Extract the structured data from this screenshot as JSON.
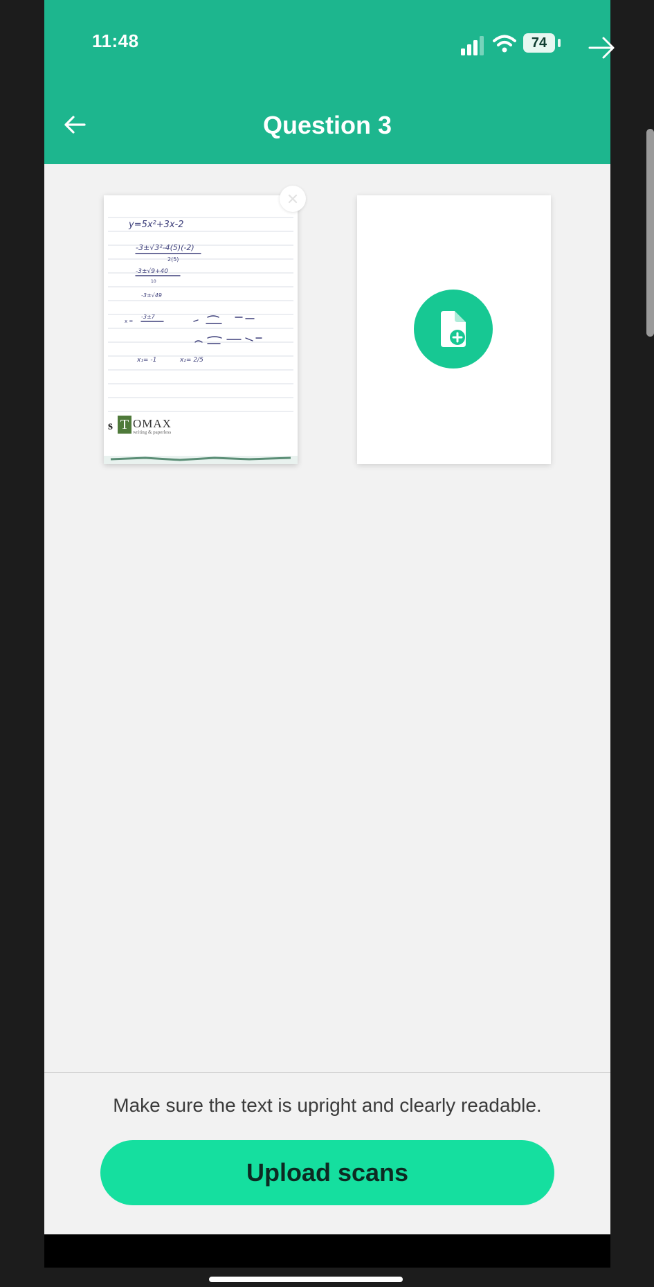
{
  "status_bar": {
    "time": "11:48",
    "battery": "74",
    "icons": [
      "signal-icon",
      "wifi-icon",
      "battery-icon"
    ]
  },
  "header": {
    "title": "Question 3",
    "back_icon": "arrow-left-icon"
  },
  "overlay": {
    "forward_icon": "arrow-right-icon"
  },
  "scan": {
    "thumbnail_handwriting": {
      "equation": "y=5x²+3x-2",
      "step_1": "-3±√3²-4(5)(-2)",
      "step_1_den": "2(5)",
      "step_2": "-3±√9+40",
      "step_2_den": "10",
      "step_3": "-3±√49",
      "step_4": "-3±7",
      "x1": "x₁= -1",
      "x2": "x₂= 2/5"
    },
    "brand_initial": "s",
    "brand_t": "T",
    "brand_name": "OMAX",
    "brand_sub": "writing & paperless"
  },
  "add_page": {
    "icon": "add-file-icon"
  },
  "footer": {
    "hint": "Make sure the text is upright and clearly readable.",
    "upload_label": "Upload scans"
  },
  "colors": {
    "header": "#1db68e",
    "accent": "#15df9f",
    "add_button": "#17c893",
    "background": "#f2f2f2"
  }
}
